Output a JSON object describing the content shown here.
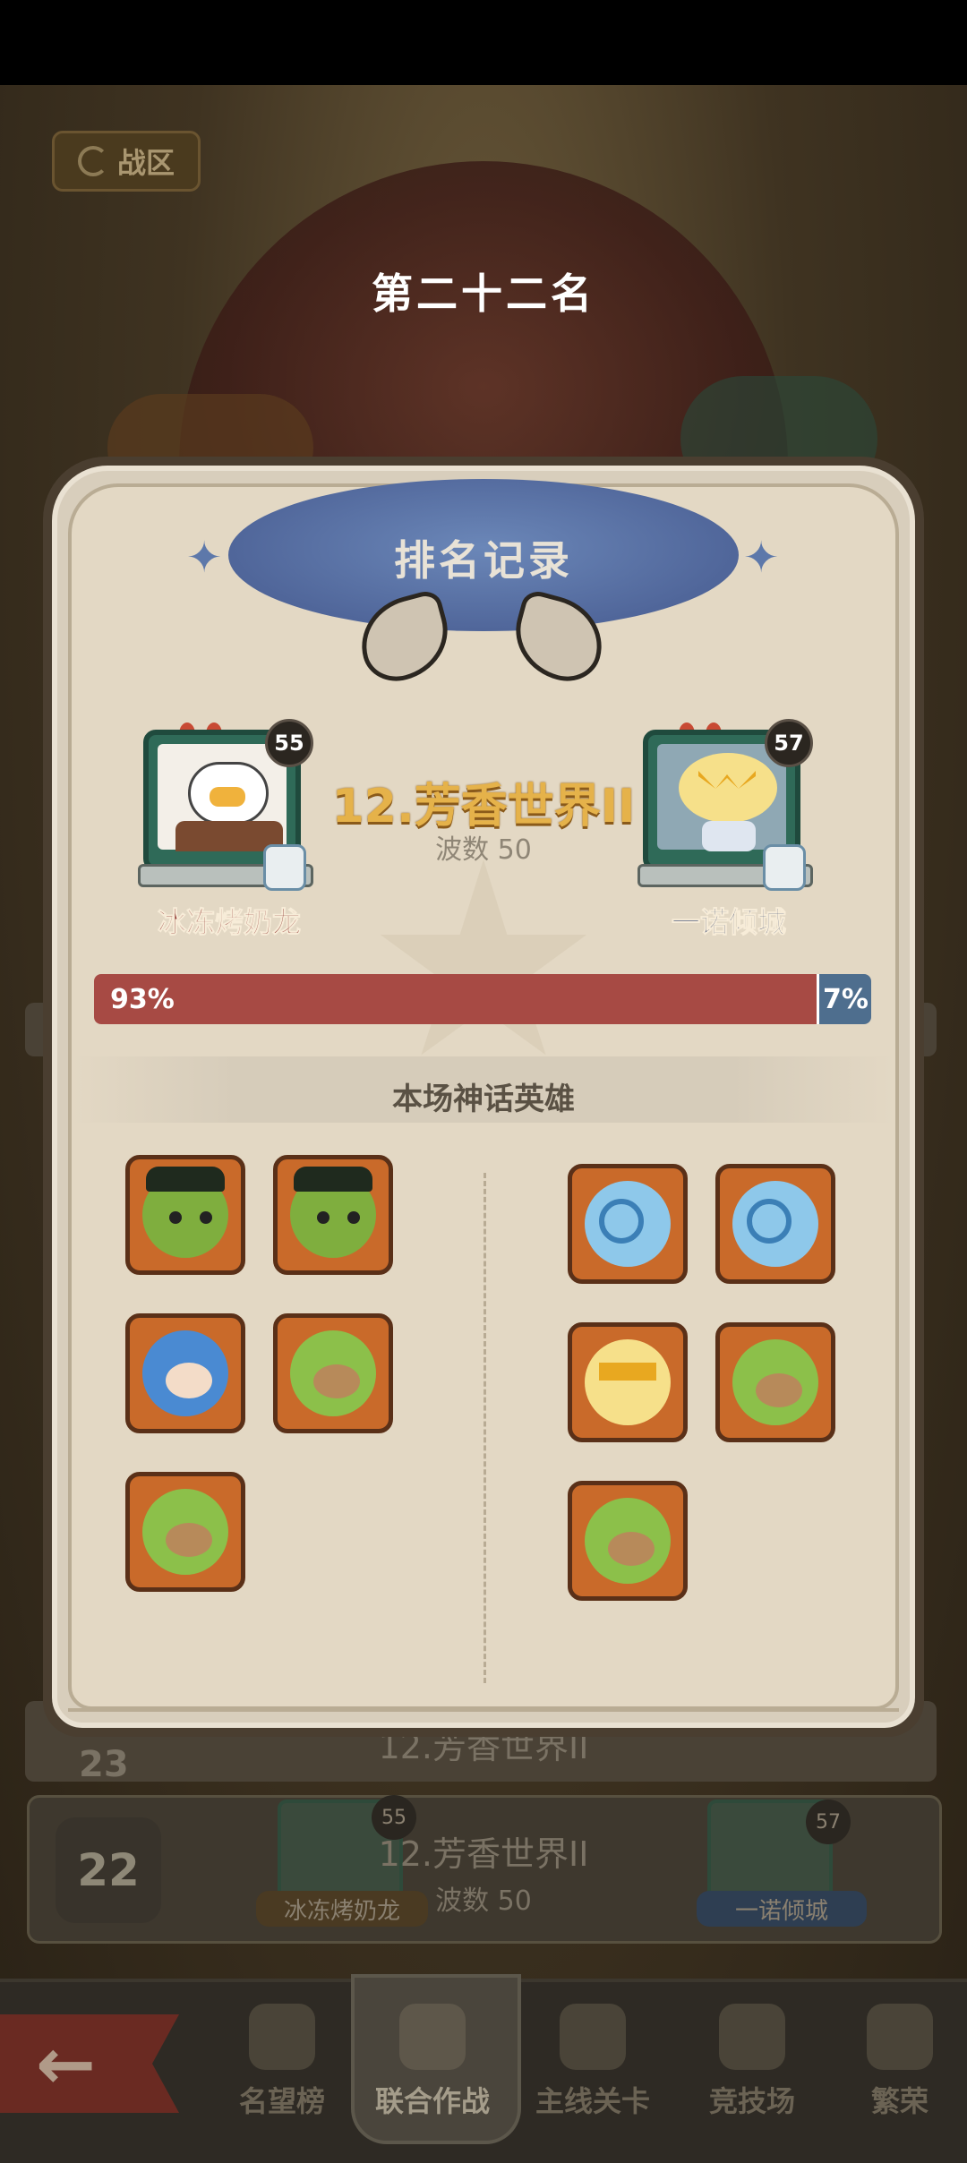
{
  "header": {
    "region_button_label": "战区",
    "rank_title": "第二十二名"
  },
  "modal": {
    "title": "排名记录",
    "stage_name": "12.芳香世界II",
    "wave_label": "波数 50",
    "left_player": {
      "name": "冰冻烤奶龙",
      "level": "55"
    },
    "right_player": {
      "name": "一诺倾城",
      "level": "57"
    },
    "progress": {
      "left_percent": "93%",
      "right_percent": "7%",
      "left_fraction": 0.93
    },
    "section_title": "本场神话英雄",
    "left_heroes": [
      "green-hat-goblin-icon",
      "green-hat-goblin-icon",
      "blue-hair-knight-icon",
      "green-leaf-goblin-icon",
      "green-leaf-goblin-icon"
    ],
    "right_heroes": [
      "ice-maid-icon",
      "ice-maid-icon",
      "lightning-cloud-icon",
      "green-leaf-goblin-icon",
      "green-leaf-goblin-icon"
    ]
  },
  "background_list": {
    "row_top_stage": "12.芳香世界II",
    "row_top_rank": "23",
    "row": {
      "rank": "22",
      "stage": "12.芳香世界II",
      "wave": "波数 50",
      "left_name": "冰冻烤奶龙",
      "left_level": "55",
      "right_name": "一诺倾城",
      "right_level": "57"
    }
  },
  "bottom_nav": {
    "items": [
      "名望榜",
      "联合作战",
      "主线关卡",
      "竞技场",
      "繁荣"
    ]
  },
  "colors": {
    "player_left_bar": "#a74a44",
    "player_right_bar": "#4e6e8e",
    "stage_gold": "#e5b24a"
  }
}
